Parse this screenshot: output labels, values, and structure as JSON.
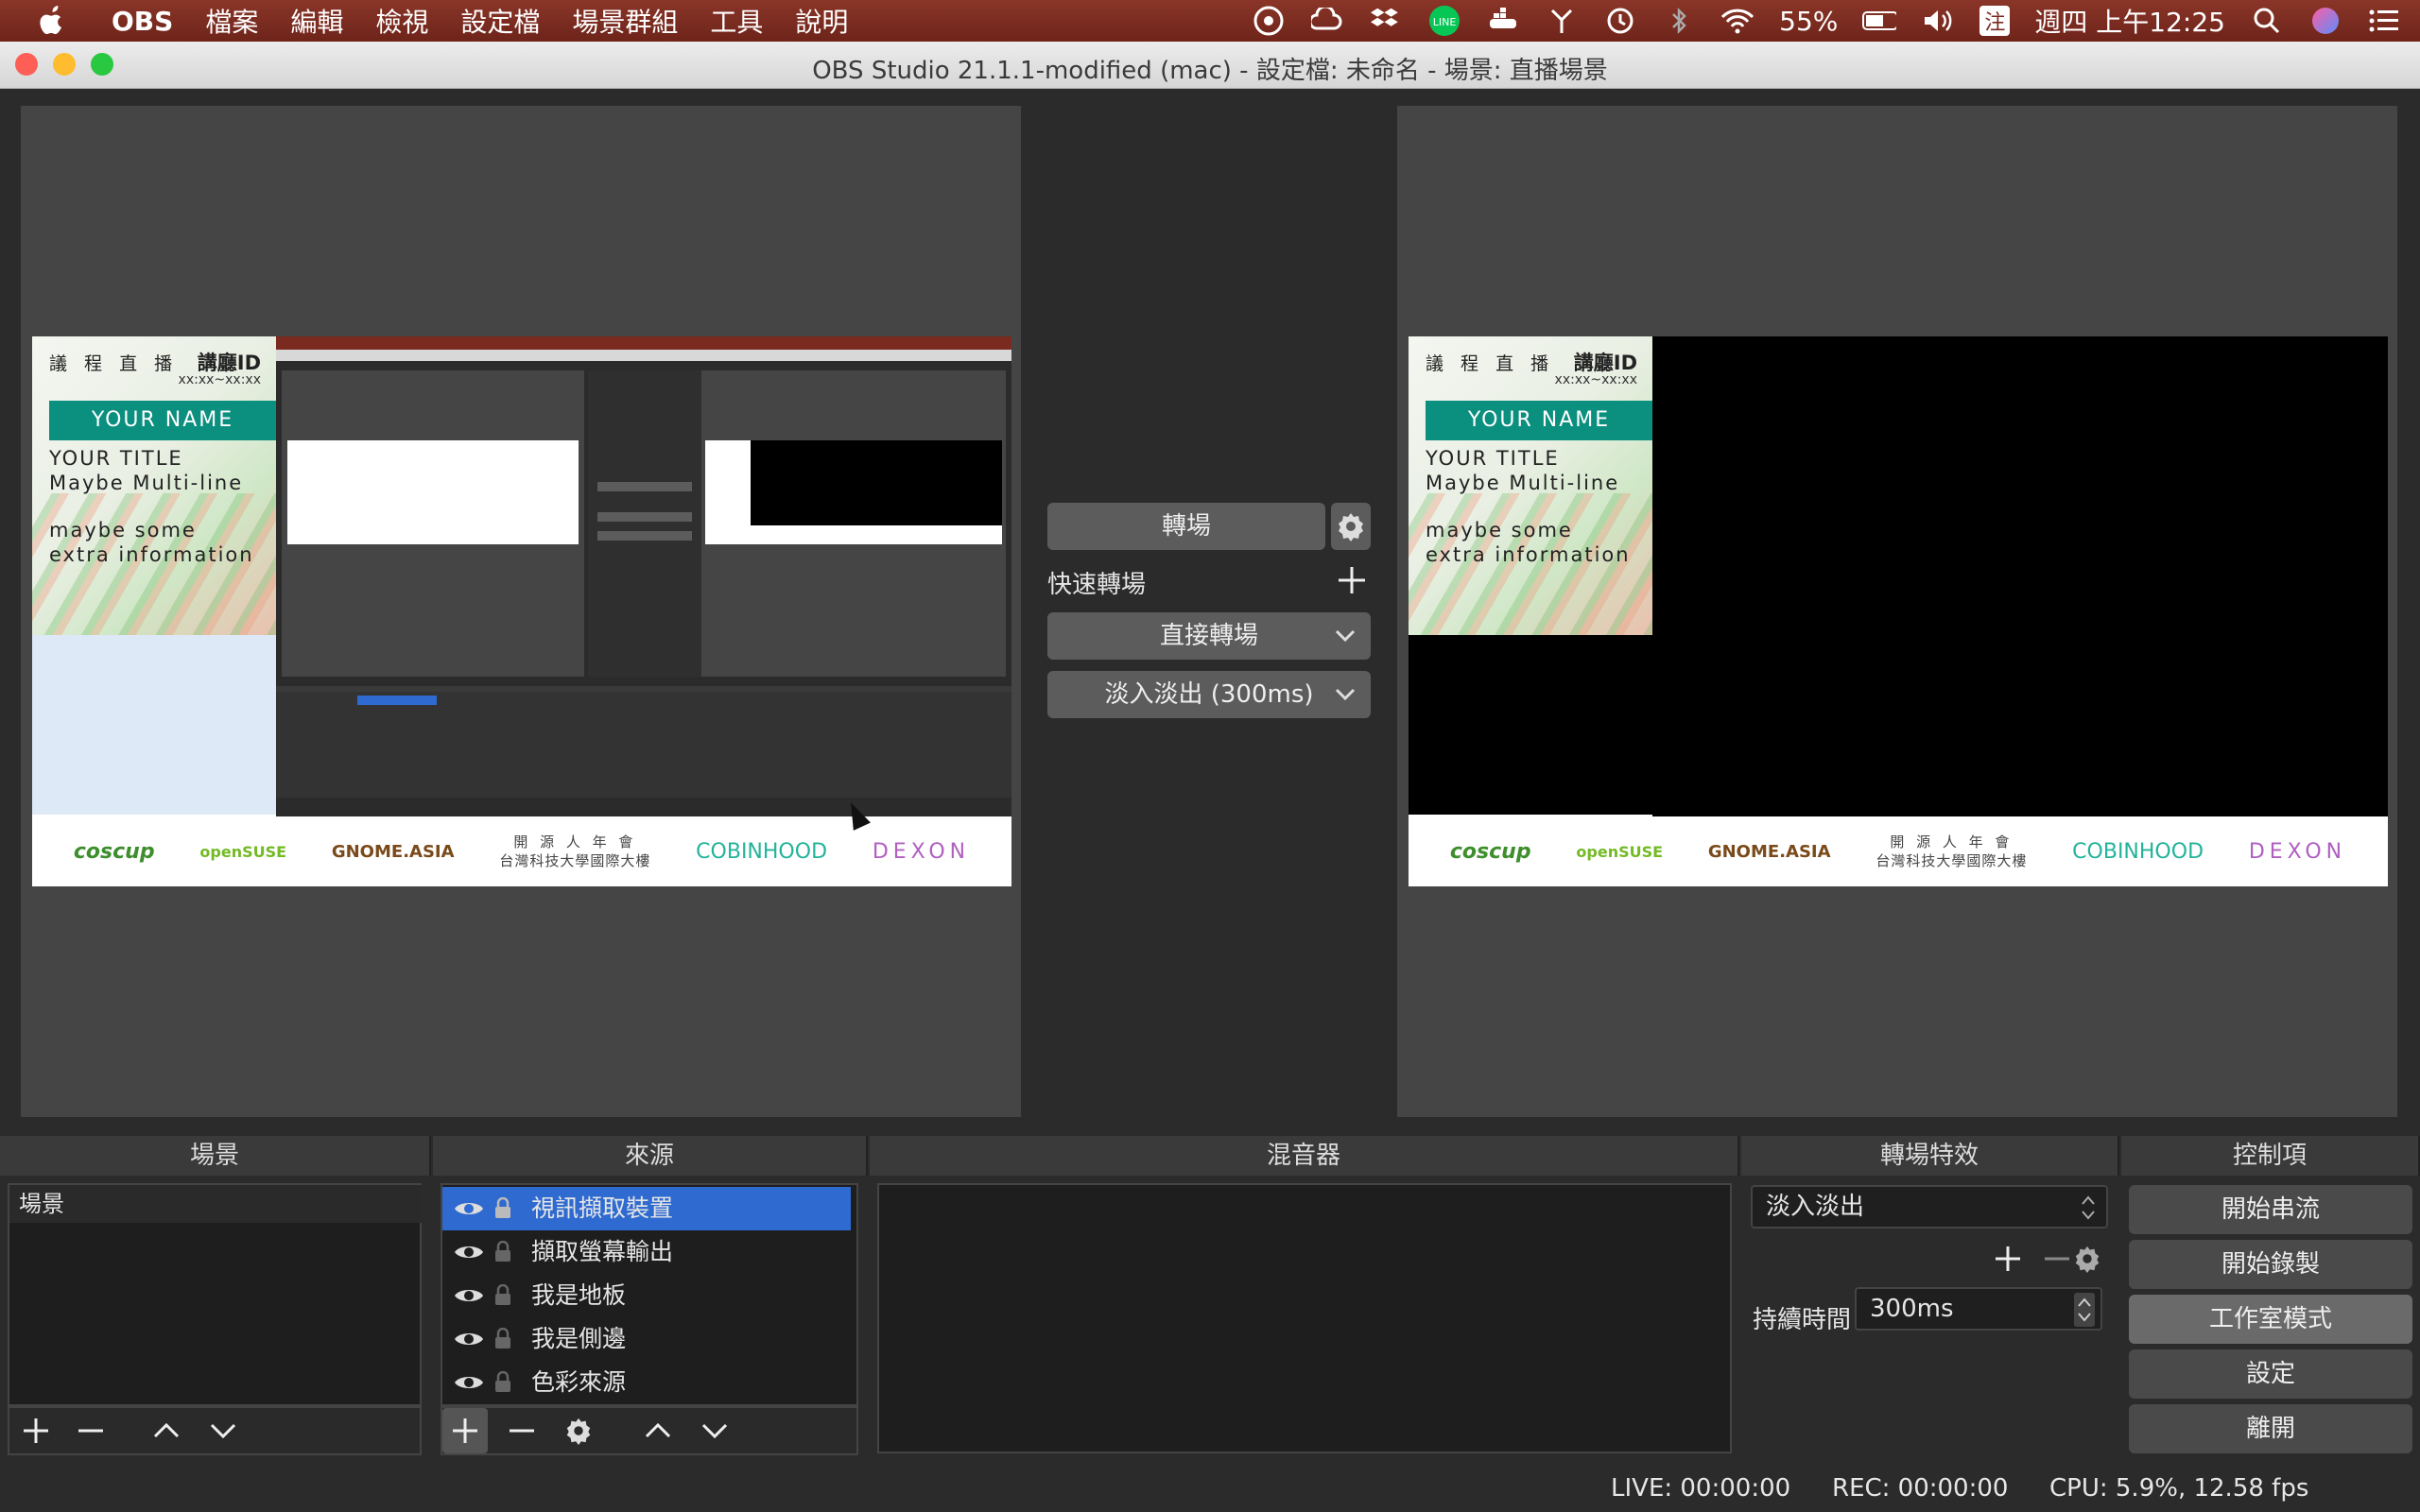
{
  "menubar": {
    "app_name": "OBS",
    "items": [
      "檔案",
      "編輯",
      "檢視",
      "設定檔",
      "場景群組",
      "工具",
      "說明"
    ],
    "battery": "55%",
    "clock": "週四 上午12:25",
    "input_method": "注"
  },
  "window": {
    "title": "OBS Studio 21.1.1-modified (mac) - 設定檔: 未命名 - 場景: 直播場景"
  },
  "slide": {
    "header": "議 程 直 播",
    "room_id": "講廳ID",
    "time": "xx:xx~xx:xx",
    "name": "YOUR NAME",
    "title_lines": [
      "YOUR TITLE",
      "Maybe Multi-line"
    ],
    "extra_lines": [
      "maybe some",
      "extra information"
    ],
    "logos": {
      "coscup": "coscup",
      "suse": "openSUSE",
      "gnome": "GNOME.ASIA",
      "osca_line1": "開 源 人 年 會",
      "osca_line2": "台灣科技大學國際大樓",
      "cobin": "COBINHOOD",
      "dexon": "DEXON"
    }
  },
  "transition_panel": {
    "transition_button": "轉場",
    "quick_label": "快速轉場",
    "cut_option": "直接轉場",
    "fade_option": "淡入淡出 (300ms)"
  },
  "docks": {
    "scenes": {
      "title": "場景",
      "items": [
        "場景"
      ]
    },
    "sources": {
      "title": "來源",
      "items": [
        "視訊擷取裝置",
        "擷取螢幕輸出",
        "我是地板",
        "我是側邊",
        "色彩來源"
      ]
    },
    "mixer": {
      "title": "混音器"
    },
    "transitions": {
      "title": "轉場特效",
      "selected": "淡入淡出",
      "duration_label": "持續時間",
      "duration_value": "300ms"
    },
    "controls": {
      "title": "控制項",
      "buttons": [
        "開始串流",
        "開始錄製",
        "工作室模式",
        "設定",
        "離開"
      ]
    }
  },
  "status": {
    "live": "LIVE: 00:00:00",
    "rec": "REC: 00:00:00",
    "cpu": "CPU: 5.9%, 12.58 fps"
  },
  "colors": {
    "menubar": "#7a2a1f",
    "panel": "#454545",
    "selection": "#2f6ad0",
    "accent_green": "#0b8f7e"
  }
}
